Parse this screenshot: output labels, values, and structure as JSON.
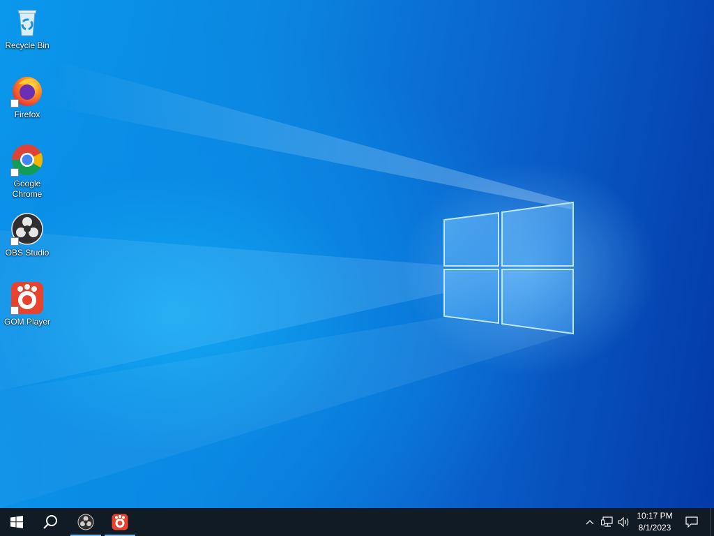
{
  "desktop": {
    "icons": [
      {
        "label": "Recycle Bin",
        "icon": "recycle-bin-icon",
        "shortcut": false
      },
      {
        "label": "Firefox",
        "icon": "firefox-icon",
        "shortcut": true
      },
      {
        "label": "Google Chrome",
        "icon": "chrome-icon",
        "shortcut": true
      },
      {
        "label": "OBS Studio",
        "icon": "obs-studio-icon",
        "shortcut": true
      },
      {
        "label": "GOM Player",
        "icon": "gom-player-icon",
        "shortcut": true
      }
    ],
    "wallpaper": "windows-10-light-logo",
    "colors": {
      "accent": "#0a78d8",
      "taskbar": "#101b26",
      "running_indicator": "#76b9ed"
    }
  },
  "taskbar": {
    "start": {
      "icon": "windows-start-icon"
    },
    "search": {
      "icon": "search-icon"
    },
    "pinned": [
      {
        "name": "OBS Studio",
        "icon": "obs-studio-icon",
        "running": true
      },
      {
        "name": "GOM Player",
        "icon": "gom-player-icon",
        "running": true
      }
    ],
    "tray": {
      "chevron": "chevron-up-icon",
      "network": "network-icon",
      "volume": "volume-icon",
      "time": "10:17 PM",
      "date": "8/1/2023",
      "notifications": "action-center-icon"
    }
  }
}
